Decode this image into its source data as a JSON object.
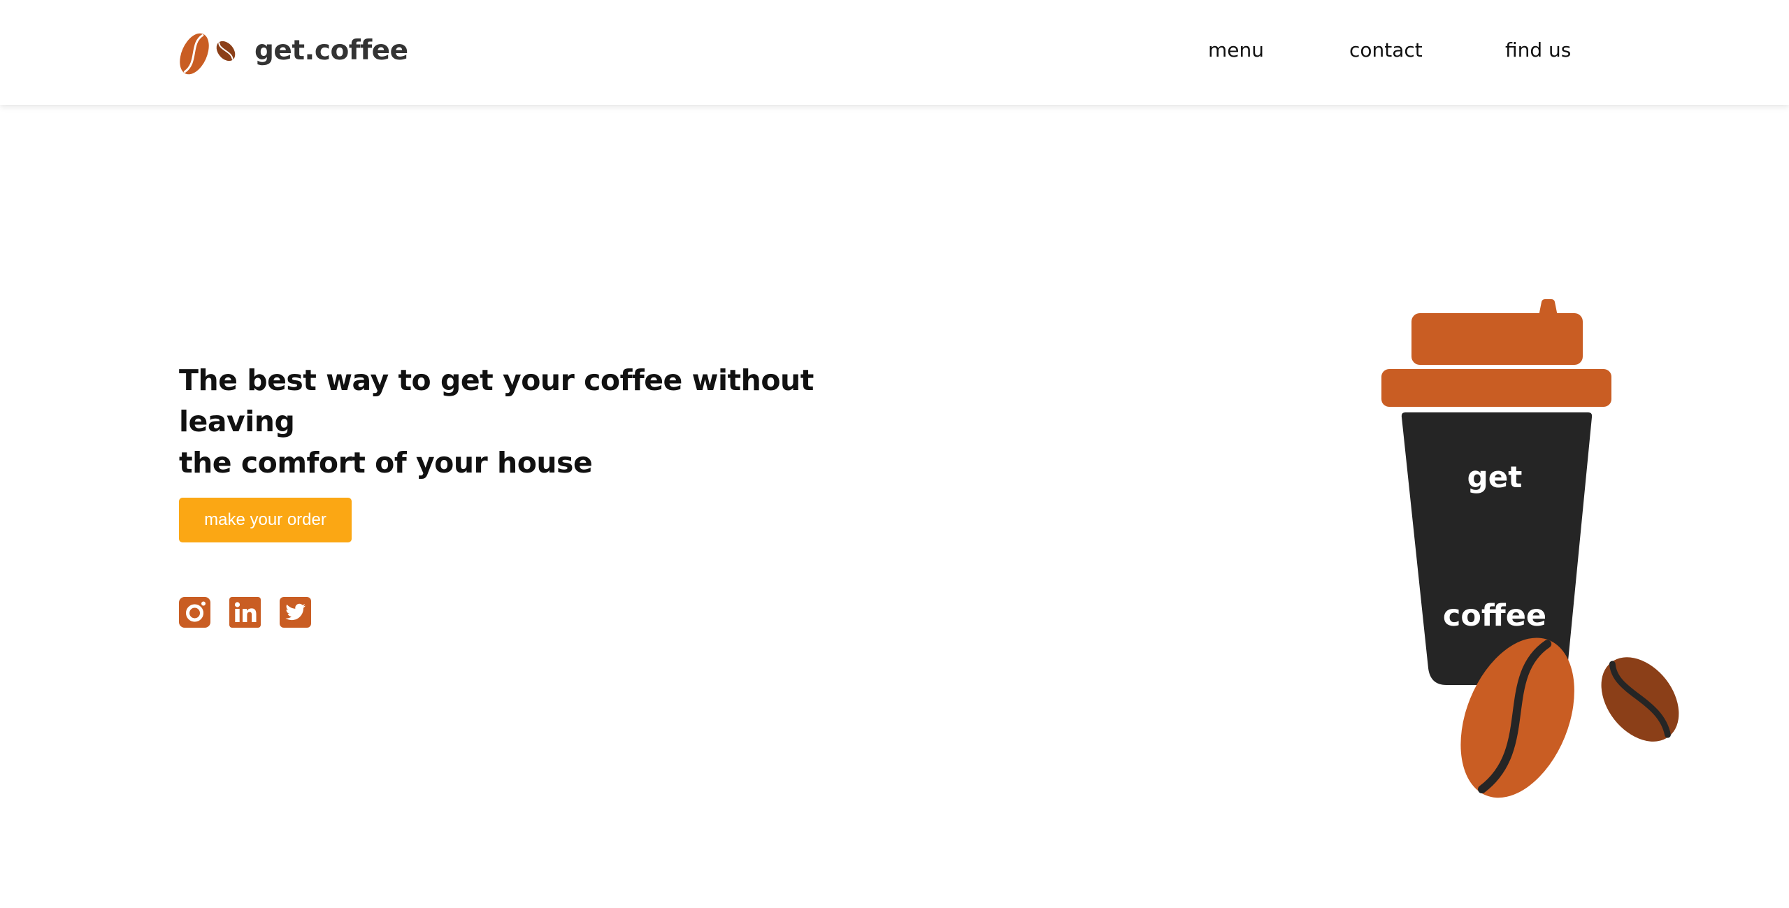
{
  "brand": {
    "name": "get.coffee",
    "logo_icon": "coffee-beans-icon",
    "colors": {
      "primary": "#c95d23",
      "secondary_bean": "#8b3f18",
      "accent_button": "#fba714",
      "cup_body": "#252525",
      "text": "#111111"
    }
  },
  "nav": {
    "items": [
      {
        "label": "menu"
      },
      {
        "label": "contact"
      },
      {
        "label": "find us"
      }
    ]
  },
  "hero": {
    "title_line1": "The best way to get your coffee without leaving",
    "title_line2": "the comfort of your house",
    "cta_label": "make your order"
  },
  "socials": [
    {
      "icon": "instagram-icon"
    },
    {
      "icon": "linkedin-icon"
    },
    {
      "icon": "twitter-icon"
    }
  ],
  "cup": {
    "top_text": "get",
    "bottom_text": "coffee",
    "icon": "coffee-cup-illustration"
  }
}
